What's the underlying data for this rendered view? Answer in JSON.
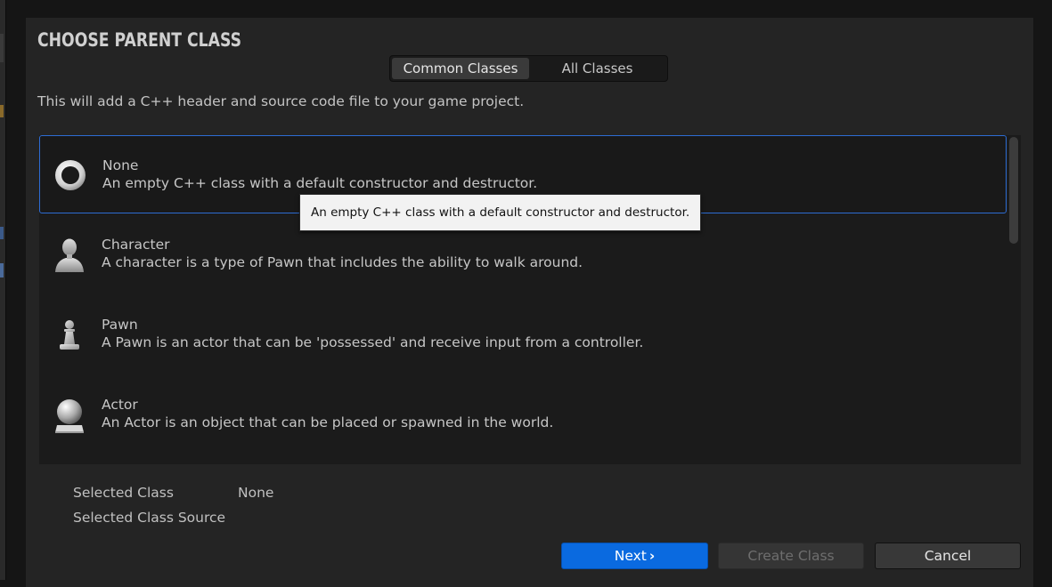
{
  "dialog": {
    "title": "CHOOSE PARENT CLASS",
    "subtitle": "This will add a C++ header and source code file to your game project."
  },
  "tabs": [
    {
      "label": "Common Classes",
      "active": true
    },
    {
      "label": "All Classes",
      "active": false
    }
  ],
  "classes": [
    {
      "name": "None",
      "description": "An empty C++ class with a default constructor and destructor.",
      "icon": "empty-ring-icon",
      "selected": true
    },
    {
      "name": "Character",
      "description": "A character is a type of Pawn that includes the ability to walk around.",
      "icon": "character-bust-icon",
      "selected": false
    },
    {
      "name": "Pawn",
      "description": "A Pawn is an actor that can be 'possessed' and receive input from a controller.",
      "icon": "chess-pawn-icon",
      "selected": false
    },
    {
      "name": "Actor",
      "description": "An Actor is an object that can be placed or spawned in the world.",
      "icon": "sphere-on-stand-icon",
      "selected": false
    }
  ],
  "tooltip": {
    "text": "An empty C++ class with a default constructor and destructor."
  },
  "info": {
    "selected_class_label": "Selected Class",
    "selected_class_value": "None",
    "selected_source_label": "Selected Class Source",
    "selected_source_value": ""
  },
  "buttons": {
    "next_label": "Next",
    "next_chevron": "›",
    "create_label": "Create Class",
    "cancel_label": "Cancel"
  },
  "colors": {
    "accent": "#0a6ae0",
    "selection_border": "#2d6cd3",
    "panel_bg": "#242424",
    "list_bg": "#1b1b1b"
  }
}
